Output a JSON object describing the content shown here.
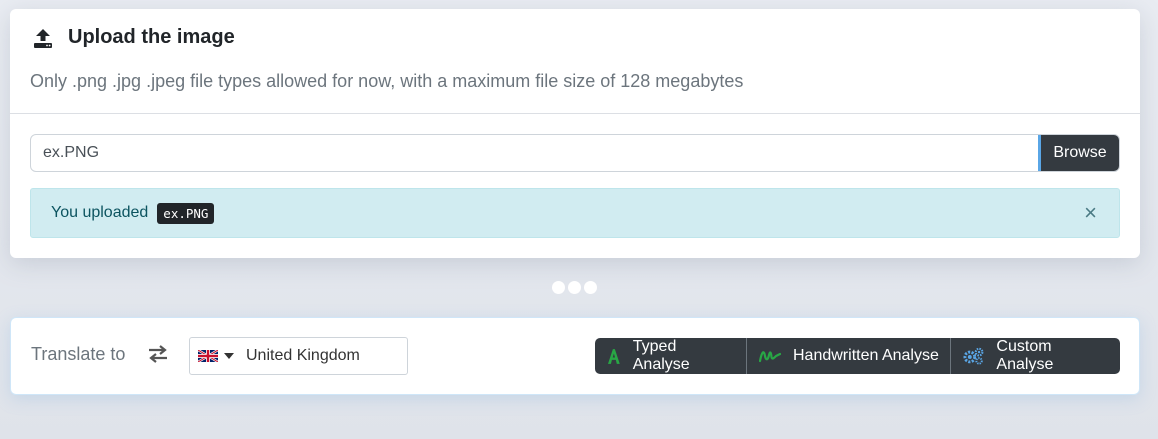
{
  "upload": {
    "title": "Upload the image",
    "description": "Only .png .jpg .jpeg file types allowed for now, with a maximum file size of 128 megabytes",
    "file_value": "ex.PNG",
    "browse_label": "Browse",
    "alert_text": "You uploaded",
    "alert_filename": "ex.PNG",
    "close_glyph": "×"
  },
  "translate": {
    "label": "Translate to",
    "country": "United Kingdom",
    "buttons": [
      {
        "label": "Typed Analyse",
        "icon": "letter-a-icon",
        "icon_color": "#28a745"
      },
      {
        "label": "Handwritten Analyse",
        "icon": "signature-icon",
        "icon_color": "#28a745"
      },
      {
        "label": "Custom Analyse",
        "icon": "cogs-icon",
        "icon_color": "#5aa6e6"
      }
    ]
  },
  "colors": {
    "dark_button": "#343a40",
    "alert_bg": "#d1ecf1",
    "accent_green": "#28a745",
    "accent_blue": "#5aa6e6"
  }
}
